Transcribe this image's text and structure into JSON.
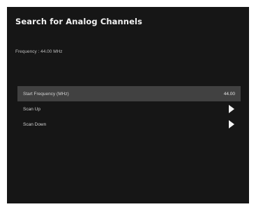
{
  "dialog": {
    "title": "Search for Analog Channels",
    "frequency_readout": "Frequency : 44.00 MHz"
  },
  "menu": {
    "items": [
      {
        "label": "Start Frequency (MHz)",
        "value": "44.00",
        "icon": ""
      },
      {
        "label": "Scan Up",
        "value": "",
        "icon": "right-arrow-icon"
      },
      {
        "label": "Scan Down",
        "value": "",
        "icon": "right-arrow-icon"
      }
    ]
  },
  "colors": {
    "screen_background": "#161616",
    "highlight": "#414141",
    "text": "#d2d2d2"
  }
}
